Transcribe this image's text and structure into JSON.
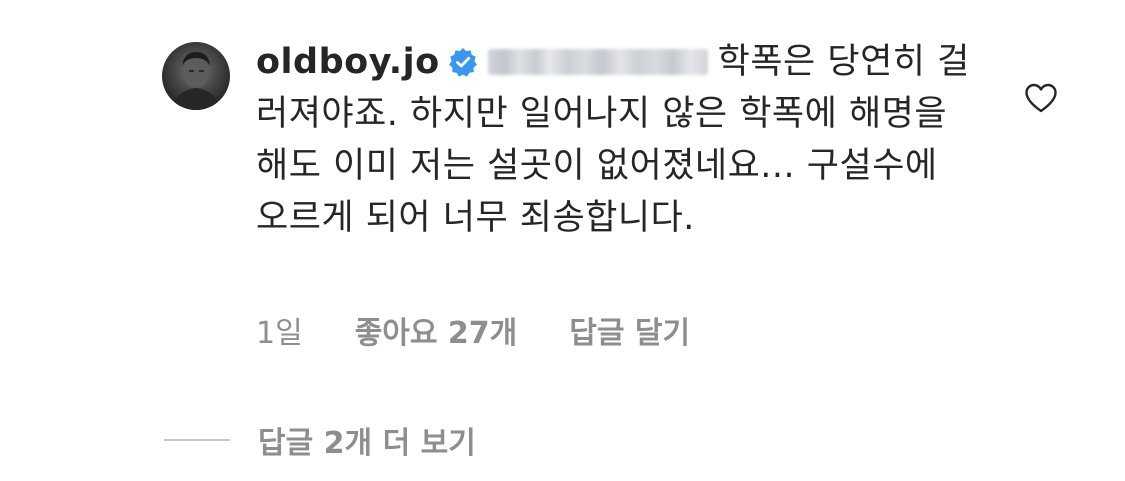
{
  "comment": {
    "username": "oldboy.jo",
    "text": "학폭은 당연히 걸러져야죠. 하지만 일어나지 않은 학폭에 해명을 해도 이미 저는 설곳이 없어졌네요... 구설수에 오르게 되어 너무 죄송합니다.",
    "time": "1일",
    "likes": "좋아요 27개",
    "reply": "답글 달기",
    "more_replies": "답글 2개 더 보기"
  },
  "colors": {
    "verified": "#3897f0",
    "muted": "#8e8e8e",
    "text": "#262626"
  },
  "icons": {
    "verified": "verified-badge-icon",
    "like": "heart-outline-icon"
  }
}
